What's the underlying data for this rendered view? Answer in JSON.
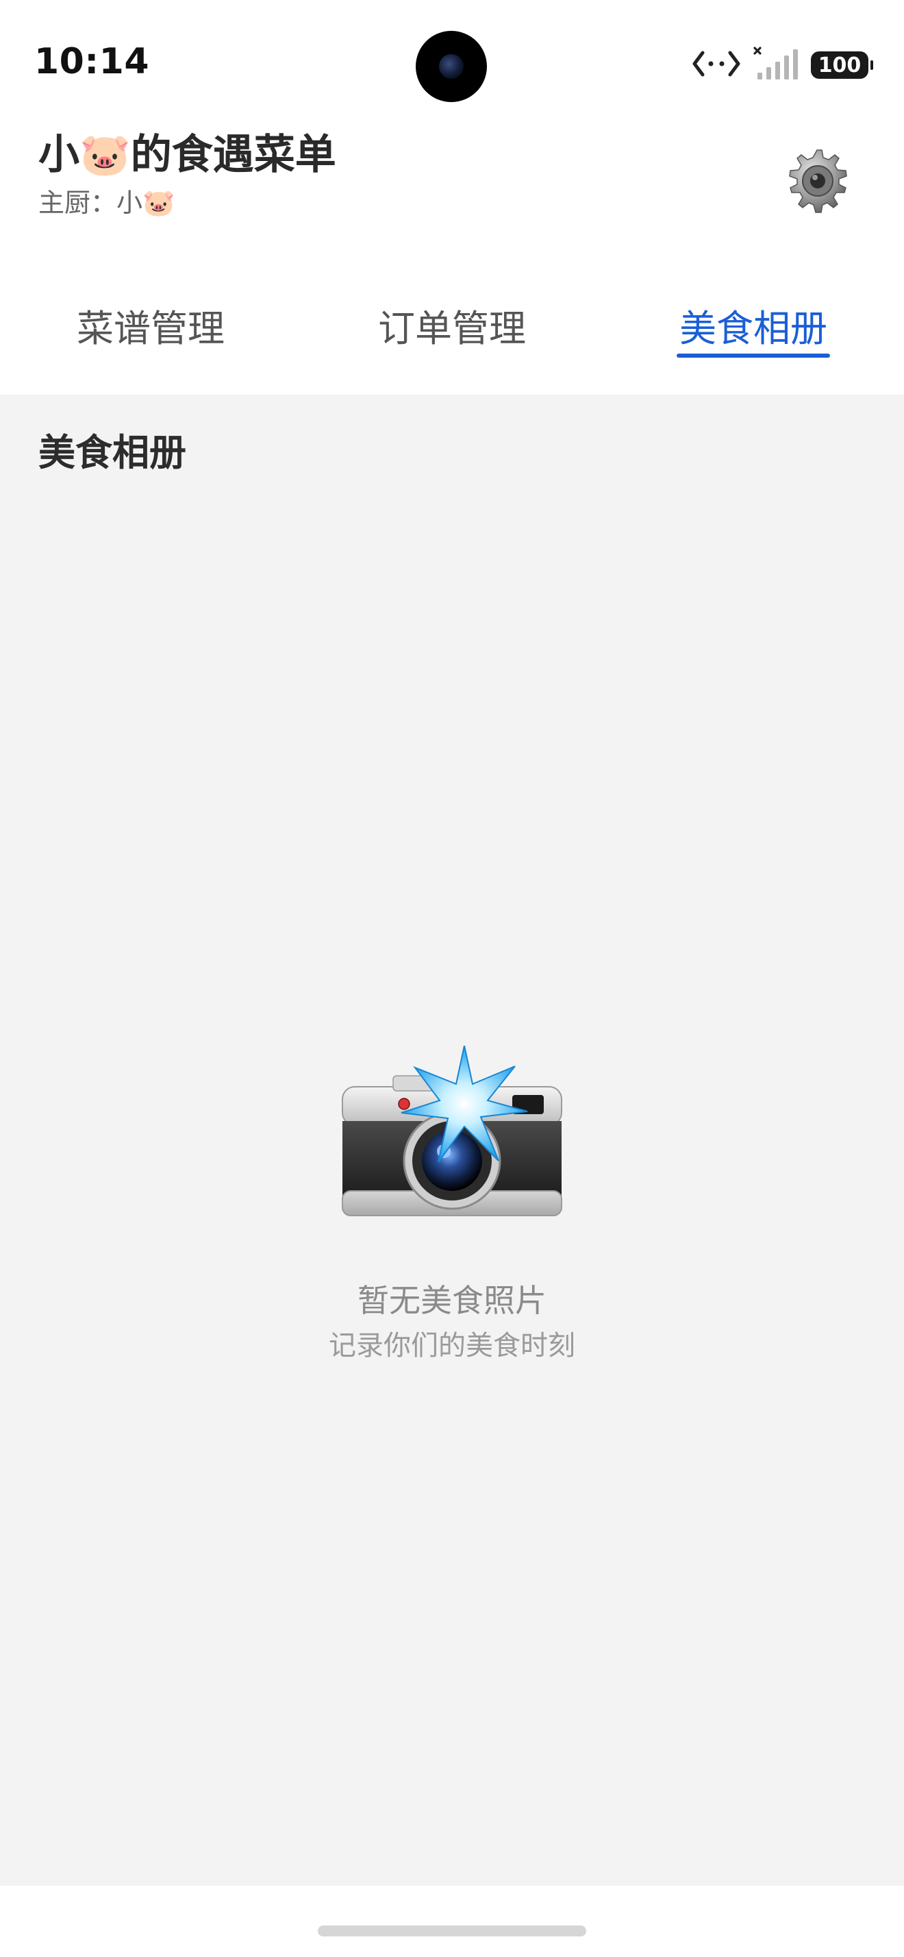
{
  "status_bar": {
    "time": "10:14",
    "battery": "100"
  },
  "header": {
    "title": "小🐷的食遇菜单",
    "chef_label": "主厨：小🐷"
  },
  "tabs": [
    {
      "label": "菜谱管理",
      "active": false
    },
    {
      "label": "订单管理",
      "active": false
    },
    {
      "label": "美食相册",
      "active": true
    }
  ],
  "album": {
    "section_title": "美食相册",
    "empty_title": "暂无美食照片",
    "empty_subtitle": "记录你们的美食时刻"
  },
  "colors": {
    "accent": "#1a5fd6",
    "background": "#f3f3f3"
  }
}
